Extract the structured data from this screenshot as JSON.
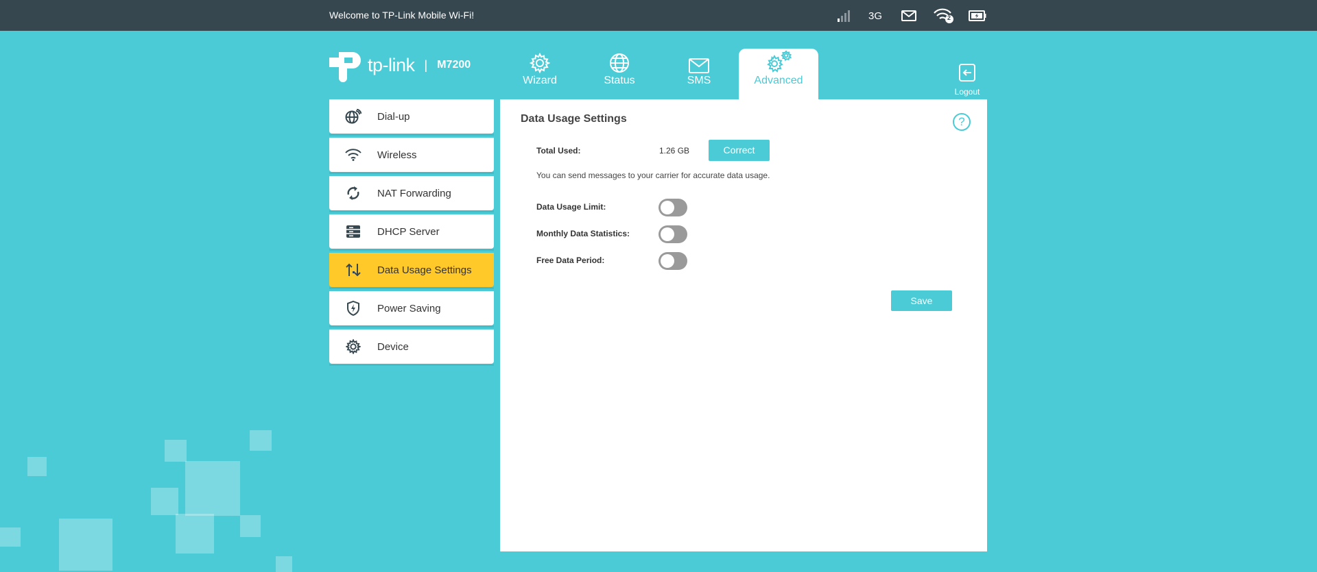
{
  "topbar": {
    "welcome": "Welcome to TP-Link Mobile Wi-Fi!",
    "network_type": "3G",
    "wifi_clients": "2"
  },
  "header": {
    "brand": "tp-link",
    "model": "M7200"
  },
  "tabs": [
    {
      "label": "Wizard",
      "icon": "gear-icon"
    },
    {
      "label": "Status",
      "icon": "globe-icon"
    },
    {
      "label": "SMS",
      "icon": "envelope-icon"
    },
    {
      "label": "Advanced",
      "icon": "gears-icon",
      "active": true
    }
  ],
  "logout": {
    "label": "Logout"
  },
  "sidebar": {
    "items": [
      {
        "label": "Dial-up",
        "icon": "globe-signal-icon"
      },
      {
        "label": "Wireless",
        "icon": "wifi-icon"
      },
      {
        "label": "NAT Forwarding",
        "icon": "sync-icon"
      },
      {
        "label": "DHCP Server",
        "icon": "server-icon"
      },
      {
        "label": "Data Usage Settings",
        "icon": "updown-arrows-icon",
        "active": true
      },
      {
        "label": "Power Saving",
        "icon": "shield-bolt-icon"
      },
      {
        "label": "Device",
        "icon": "gear-icon"
      }
    ]
  },
  "main": {
    "title": "Data Usage Settings",
    "help": "?",
    "total_used_label": "Total Used:",
    "total_used_value": "1.26 GB",
    "correct_button": "Correct",
    "hint": "You can send messages to your carrier for accurate data usage.",
    "toggles": [
      {
        "label": "Data Usage Limit:",
        "on": false
      },
      {
        "label": "Monthly Data Statistics:",
        "on": false
      },
      {
        "label": "Free Data Period:",
        "on": false
      }
    ],
    "save_button": "Save"
  },
  "colors": {
    "background": "#4acbd6",
    "topbar": "#37474f",
    "active_sidebar": "#ffc929",
    "accent": "#4acbd6"
  }
}
